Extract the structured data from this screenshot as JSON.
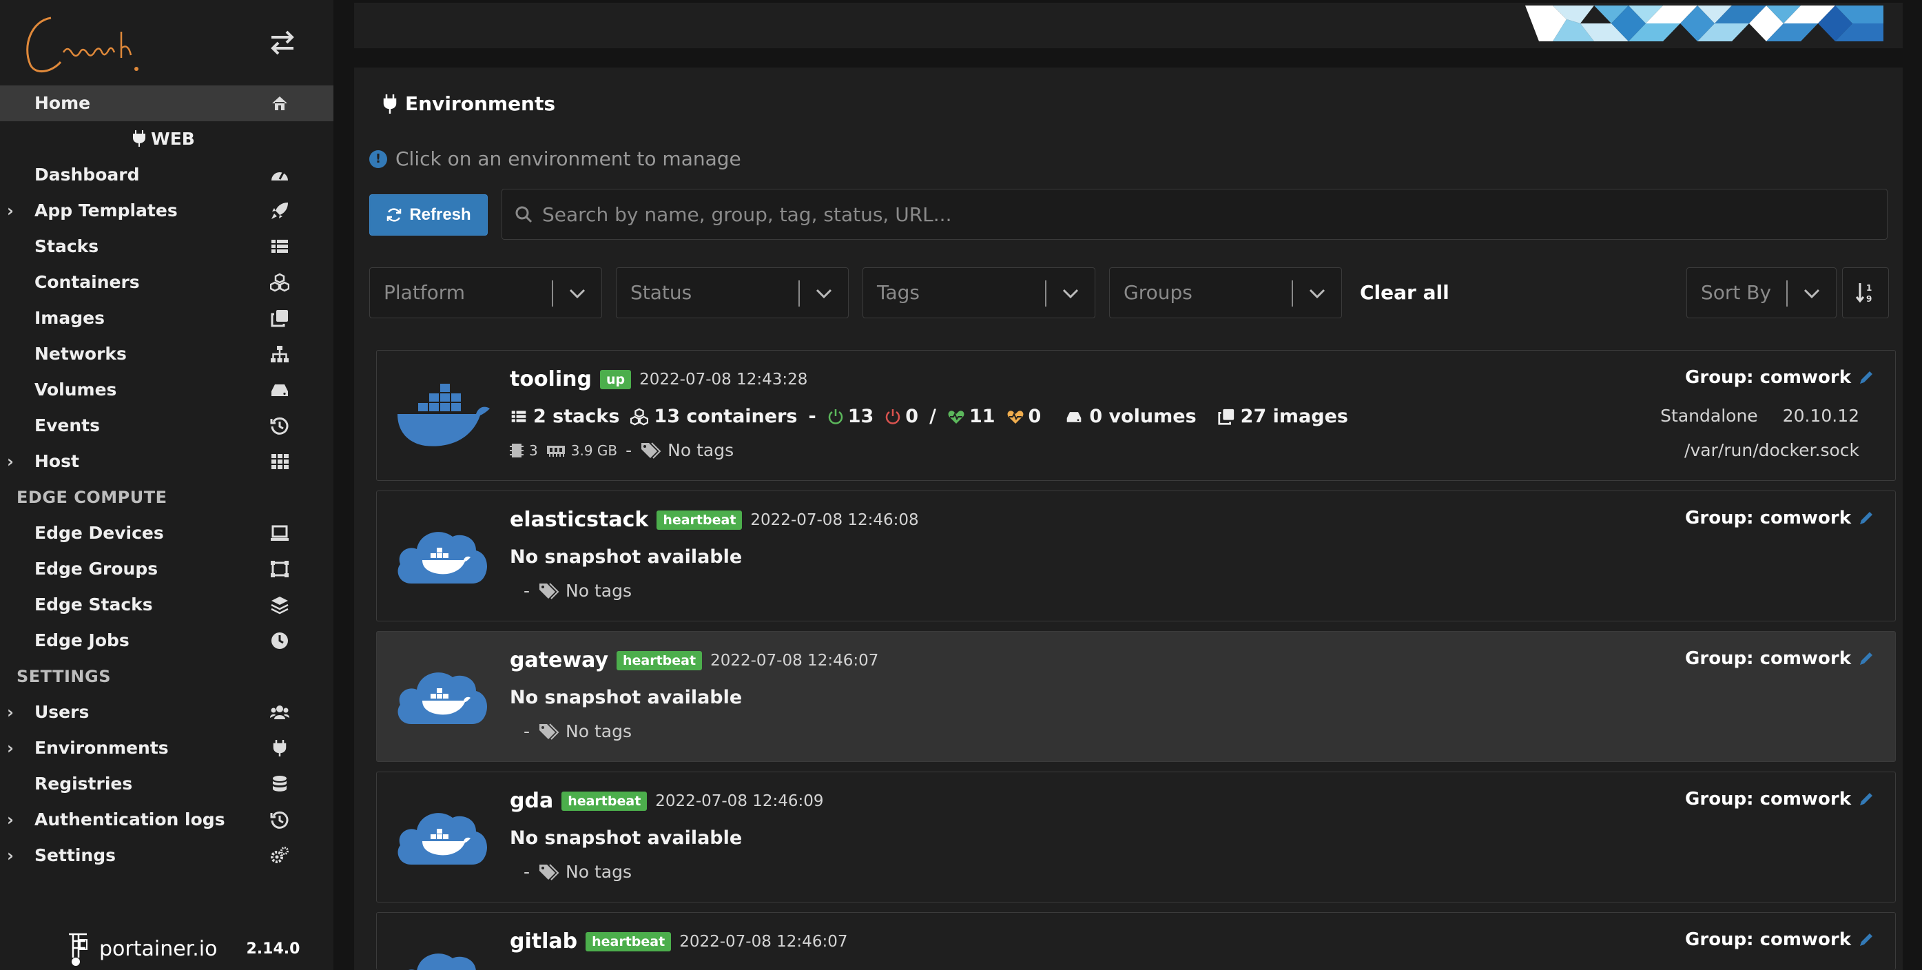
{
  "sidebar": {
    "items": [
      {
        "label": "Home",
        "icon": "home-icon",
        "active": true
      },
      {
        "label": "Dashboard",
        "icon": "dashboard-icon"
      },
      {
        "label": "App Templates",
        "icon": "rocket-icon",
        "expandable": true
      },
      {
        "label": "Stacks",
        "icon": "list-icon"
      },
      {
        "label": "Containers",
        "icon": "cubes-icon"
      },
      {
        "label": "Images",
        "icon": "clone-icon"
      },
      {
        "label": "Networks",
        "icon": "sitemap-icon"
      },
      {
        "label": "Volumes",
        "icon": "hdd-icon"
      },
      {
        "label": "Events",
        "icon": "history-icon"
      },
      {
        "label": "Host",
        "icon": "th-icon",
        "expandable": true
      }
    ],
    "env_label": "WEB",
    "edge_header": "EDGE COMPUTE",
    "edge_items": [
      {
        "label": "Edge Devices",
        "icon": "laptop-icon"
      },
      {
        "label": "Edge Groups",
        "icon": "object-group-icon"
      },
      {
        "label": "Edge Stacks",
        "icon": "layer-group-icon"
      },
      {
        "label": "Edge Jobs",
        "icon": "clock-icon"
      }
    ],
    "settings_header": "SETTINGS",
    "settings_items": [
      {
        "label": "Users",
        "icon": "users-icon",
        "expandable": true
      },
      {
        "label": "Environments",
        "icon": "plug-icon",
        "expandable": true
      },
      {
        "label": "Registries",
        "icon": "database-icon"
      },
      {
        "label": "Authentication logs",
        "icon": "history-icon",
        "expandable": true
      },
      {
        "label": "Settings",
        "icon": "cogs-icon",
        "expandable": true
      }
    ],
    "footer": {
      "brand": "portainer.io",
      "version": "2.14.0"
    }
  },
  "panel": {
    "title": "Environments",
    "hint": "Click on an environment to manage",
    "refresh_label": "Refresh",
    "search_placeholder": "Search by name, group, tag, status, URL...",
    "filters": {
      "platform": "Platform",
      "status": "Status",
      "tags": "Tags",
      "groups": "Groups",
      "clear_all": "Clear all",
      "sort_by": "Sort By"
    }
  },
  "environments": [
    {
      "name": "tooling",
      "badge": "up",
      "time": "2022-07-08 12:43:28",
      "stacks": "2 stacks",
      "containers": "13 containers",
      "running": "13",
      "stopped": "0",
      "healthy": "11",
      "unhealthy": "0",
      "volumes": "0 volumes",
      "images": "27 images",
      "cpu": "3",
      "mem": "3.9 GB",
      "tags": "No tags",
      "group": "Group: comwork",
      "type": "Standalone",
      "docker_version": "20.10.12",
      "url": "/var/run/docker.sock"
    },
    {
      "name": "elasticstack",
      "badge": "heartbeat",
      "time": "2022-07-08 12:46:08",
      "snapshot": "No snapshot available",
      "tags": "No tags",
      "group": "Group: comwork"
    },
    {
      "name": "gateway",
      "badge": "heartbeat",
      "time": "2022-07-08 12:46:07",
      "snapshot": "No snapshot available",
      "tags": "No tags",
      "group": "Group: comwork"
    },
    {
      "name": "gda",
      "badge": "heartbeat",
      "time": "2022-07-08 12:46:09",
      "snapshot": "No snapshot available",
      "tags": "No tags",
      "group": "Group: comwork"
    },
    {
      "name": "gitlab",
      "badge": "heartbeat",
      "time": "2022-07-08 12:46:07",
      "group": "Group: comwork"
    }
  ],
  "colors": {
    "accent": "#337ab7",
    "badge_green": "#4cae4c",
    "sidebar_bg": "#1d1d1d",
    "panel_bg": "#1f1f1f",
    "active_item": "#3a3a3a",
    "docker_blue": "#3f7ec3"
  }
}
